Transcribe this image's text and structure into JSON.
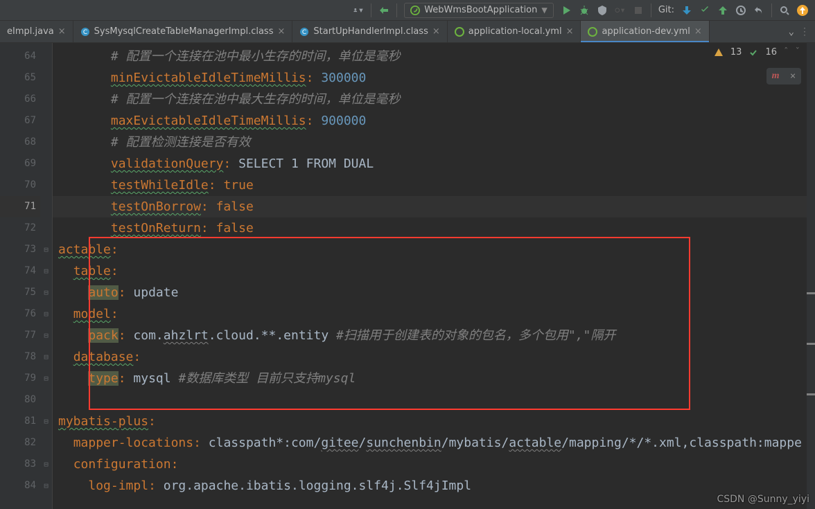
{
  "toolbar": {
    "runConfig": "WebWmsBootApplication",
    "gitLabel": "Git:"
  },
  "tabs": [
    {
      "label": "eImpl.java",
      "type": "java",
      "active": false
    },
    {
      "label": "SysMysqlCreateTableManagerImpl.class",
      "type": "class",
      "active": false
    },
    {
      "label": "StartUpHandlerImpl.class",
      "type": "class",
      "active": false
    },
    {
      "label": "application-local.yml",
      "type": "yml",
      "active": false
    },
    {
      "label": "application-dev.yml",
      "type": "yml",
      "active": true
    }
  ],
  "inspections": {
    "warnings": "13",
    "weak": "16"
  },
  "gutter": [
    "64",
    "65",
    "66",
    "67",
    "68",
    "69",
    "70",
    "71",
    "72",
    "73",
    "74",
    "75",
    "76",
    "77",
    "78",
    "79",
    "80",
    "81",
    "82",
    "83",
    "84"
  ],
  "code": {
    "l64": "# 配置一个连接在池中最小生存的时间，单位是毫秒",
    "l65k": "minEvictableIdleTimeMillis",
    "l65v": "300000",
    "l66": "# 配置一个连接在池中最大生存的时间，单位是毫秒",
    "l67k": "maxEvictableIdleTimeMillis",
    "l67v": "900000",
    "l68": "# 配置检测连接是否有效",
    "l69k": "validationQuery",
    "l69v": "SELECT 1 FROM DUAL",
    "l70k": "testWhileIdle",
    "l70v": "true",
    "l71k": "testOnBorrow",
    "l71v": "false",
    "l72k": "testOnReturn",
    "l72v": "false",
    "l73k": "actable",
    "l74k": "table",
    "l75k": "auto",
    "l75v": "update",
    "l76k": "model",
    "l77k": "pack",
    "l77v1": "com.",
    "l77v2": "ahzlrt",
    "l77v3": ".cloud.**.entity ",
    "l77c": "#扫描用于创建表的对象的包名，多个包用\",\"隔开",
    "l78k": "database",
    "l79k": "type",
    "l79v": "mysql ",
    "l79c": "#数据库类型 目前只支持mysql",
    "l81k": "mybatis-plus",
    "l82k": "mapper-locations",
    "l82v1": "classpath*:com/",
    "l82u1": "gitee",
    "l82s1": "/",
    "l82u2": "sunchenbin",
    "l82s2": "/mybatis/",
    "l82u3": "actable",
    "l82v2": "/mapping/*/*.xml,classpath:mappe",
    "l83k": "configuration",
    "l84k": "log-impl",
    "l84v": "org.apache.ibatis.logging.slf4j.Slf4jImpl"
  },
  "watermark": "CSDN @Sunny_yiyi"
}
